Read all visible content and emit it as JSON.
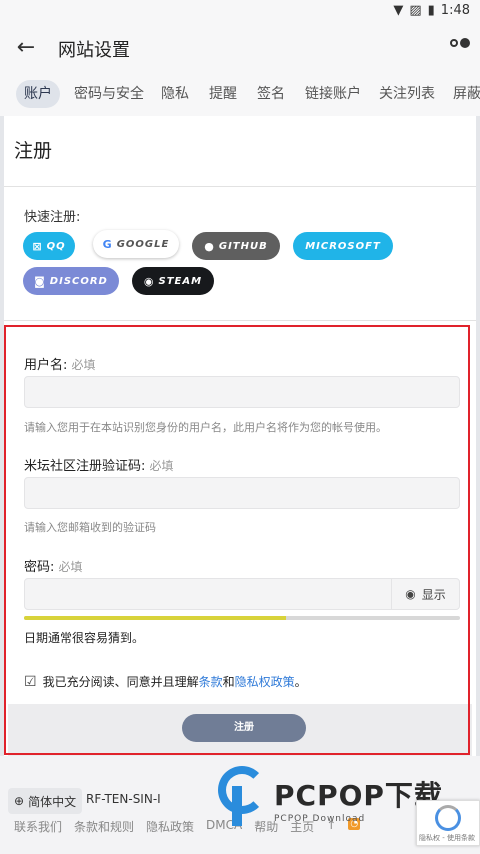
{
  "status_bar": {
    "time": "1:48"
  },
  "app_bar": {
    "back_icon": "arrow-left-icon",
    "title": "网站设置"
  },
  "tabs": [
    {
      "label": "账户",
      "active": true
    },
    {
      "label": "密码与安全"
    },
    {
      "label": "隐私"
    },
    {
      "label": "提醒"
    },
    {
      "label": "签名"
    },
    {
      "label": "链接账户"
    },
    {
      "label": "关注列表"
    },
    {
      "label": "屏蔽"
    }
  ],
  "section": {
    "title": "注册"
  },
  "quick": {
    "label": "快速注册:",
    "providers": [
      {
        "label": "QQ",
        "color": "#20b4e8"
      },
      {
        "label": "GOOGLE",
        "color": "#ffffff"
      },
      {
        "label": "GITHUB",
        "color": "#5f5f5f"
      },
      {
        "label": "MICROSOFT",
        "color": "#20b4e8"
      },
      {
        "label": "DISCORD",
        "color": "#7b8ad6"
      },
      {
        "label": "STEAM",
        "color": "#17191c"
      }
    ]
  },
  "form": {
    "username": {
      "label": "用户名:",
      "required": "必填",
      "help": "请输入您用于在本站识别您身份的用户名，此用户名将作为您的帐号使用。"
    },
    "code": {
      "label": "米坛社区注册验证码:",
      "required": "必填",
      "help": "请输入您邮箱收到的验证码"
    },
    "password": {
      "label": "密码:",
      "required": "必填",
      "toggle": "显示",
      "strength_level": 0.6,
      "strength_text": "日期通常很容易猜到。"
    },
    "agree": {
      "prefix": "我已充分阅读、同意并且理解",
      "terms": "条款",
      "and": "和",
      "privacy": "隐私权政策",
      "suffix": "。"
    },
    "submit": "注册"
  },
  "footer": {
    "language": "简体中文",
    "code": "RF-TEN-SIN-I",
    "links": [
      "联系我们",
      "条款和规则",
      "隐私政策",
      "DMCA",
      "帮助",
      "主页",
      "↑"
    ]
  },
  "watermark": {
    "big": "PCPOP下载",
    "small": "PCPOP Download"
  },
  "recaptcha": {
    "text": "隐私权 - 使用条款"
  }
}
